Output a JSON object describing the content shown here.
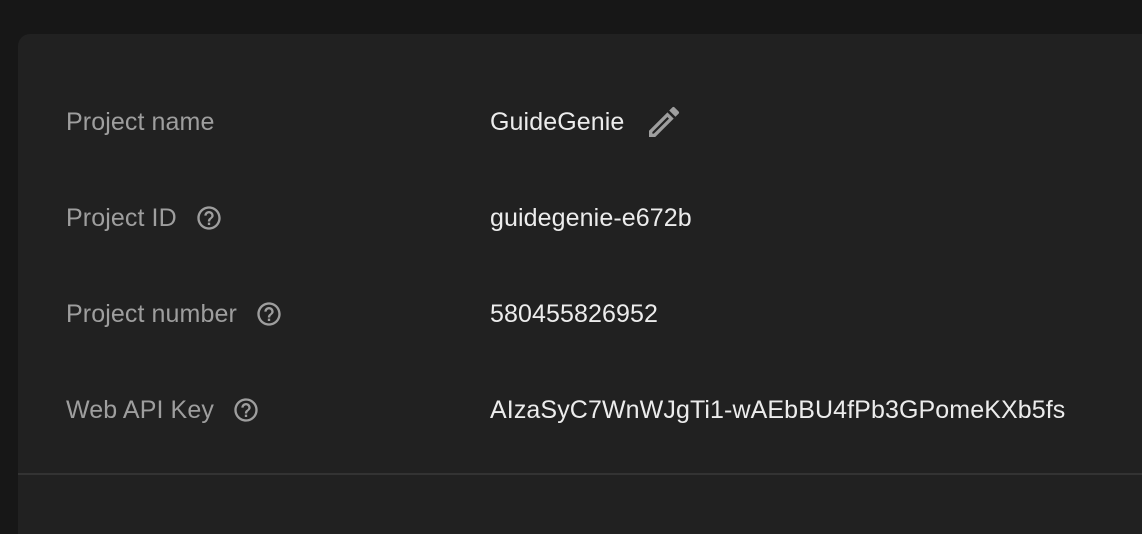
{
  "project": {
    "name_label": "Project name",
    "name_value": "GuideGenie",
    "id_label": "Project ID",
    "id_value": "guidegenie-e672b",
    "number_label": "Project number",
    "number_value": "580455826952",
    "api_key_label": "Web API Key",
    "api_key_value": "AIzaSyC7WnWJgTi1-wAEbBU4fPb3GPomeKXb5fs"
  },
  "icons": {
    "edit": "pencil-icon",
    "help": "help-circle-icon"
  },
  "colors": {
    "background": "#171717",
    "card": "#212121",
    "label_text": "#9e9e9e",
    "value_text": "#ececec",
    "icon": "#9e9e9e",
    "divider": "#333333"
  }
}
